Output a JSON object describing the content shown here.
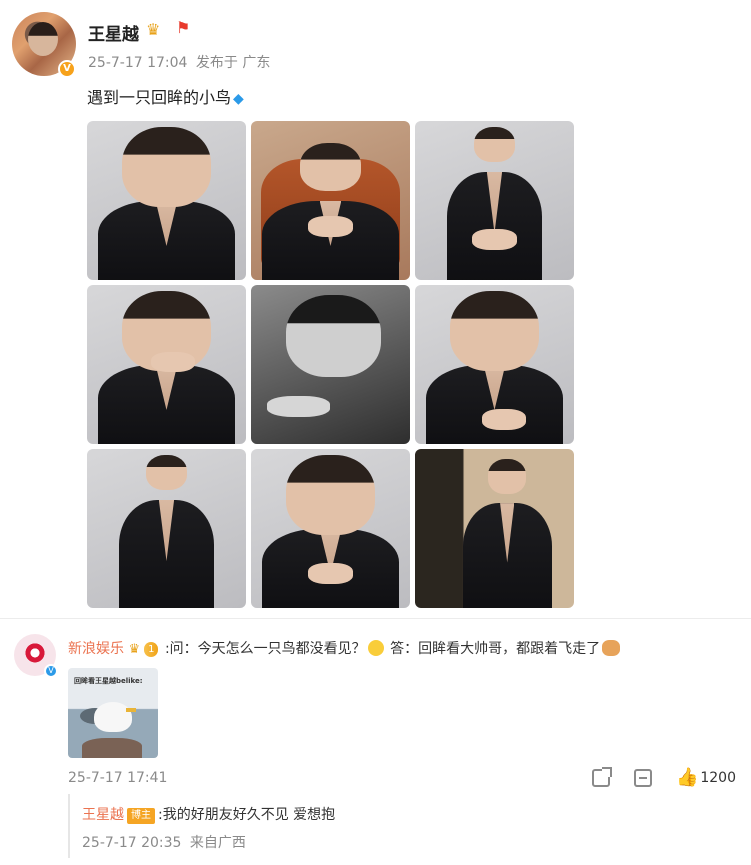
{
  "post": {
    "author": "王星越",
    "time": "25-7-17 17:04",
    "source": "发布于 广东",
    "text": "遇到一只回眸的小鸟",
    "icons": {
      "verified": "verified-v-badge",
      "crown": "crown-icon",
      "flag": "red-flag-icon",
      "diamond": "diamond-icon"
    },
    "photos": [
      {
        "name": "photo-1",
        "style": "grey-closeup"
      },
      {
        "name": "photo-2",
        "style": "warm-chair"
      },
      {
        "name": "photo-3",
        "style": "grey-standing"
      },
      {
        "name": "photo-4",
        "style": "grey-hand-face"
      },
      {
        "name": "photo-5",
        "style": "black-white"
      },
      {
        "name": "photo-6",
        "style": "grey-hand-chest"
      },
      {
        "name": "photo-7",
        "style": "grey-standing"
      },
      {
        "name": "photo-8",
        "style": "grey-closeup"
      },
      {
        "name": "photo-9",
        "style": "room-standing"
      }
    ]
  },
  "comment": {
    "author": "新浪娱乐",
    "level": "1",
    "text": ":问：今天怎么一只鸟都没看见？",
    "text2": "答：回眸看大帅哥，都跟着飞走了",
    "thumb_caption": "回眸看王星越belike:",
    "time": "25-7-17 17:41",
    "like_count": "1200"
  },
  "reply": {
    "author": "王星越",
    "badge": "博主",
    "text": ":我的好朋友好久不见 爱想抱",
    "time": "25-7-17 20:35",
    "source": "来自广西"
  },
  "colors": {
    "link": "#eb7350",
    "meta": "#8a8a8a",
    "like": "#f0762e",
    "badge": "#f5a524"
  }
}
